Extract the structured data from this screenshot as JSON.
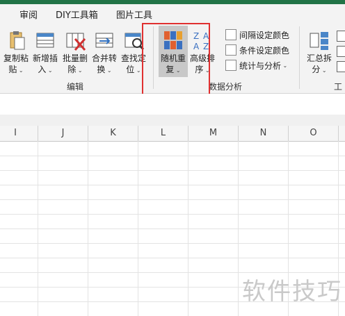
{
  "tabs": [
    "审阅",
    "DIY工具箱",
    "图片工具"
  ],
  "ribbon": {
    "edit_group": {
      "label": "编辑",
      "buttons": [
        {
          "line1": "复制粘",
          "line2": "贴"
        },
        {
          "line1": "新增插",
          "line2": "入"
        },
        {
          "line1": "批量删",
          "line2": "除"
        },
        {
          "line1": "合并转",
          "line2": "换"
        },
        {
          "line1": "查找定",
          "line2": "位"
        }
      ]
    },
    "analysis_group": {
      "label": "数据分析",
      "buttons": [
        {
          "line1": "随机重",
          "line2": "复"
        },
        {
          "line1": "高级排",
          "line2": "序"
        }
      ],
      "small_buttons": [
        "间隔设定颜色",
        "条件设定颜色",
        "统计与分析"
      ]
    },
    "right_group": {
      "label": "工",
      "button": {
        "line1": "汇总拆",
        "line2": "分"
      }
    }
  },
  "columns": [
    "I",
    "J",
    "K",
    "L",
    "M",
    "N",
    "O"
  ],
  "watermark": "软件技巧",
  "colors": {
    "accent": "#217346",
    "highlight": "#e03030"
  }
}
